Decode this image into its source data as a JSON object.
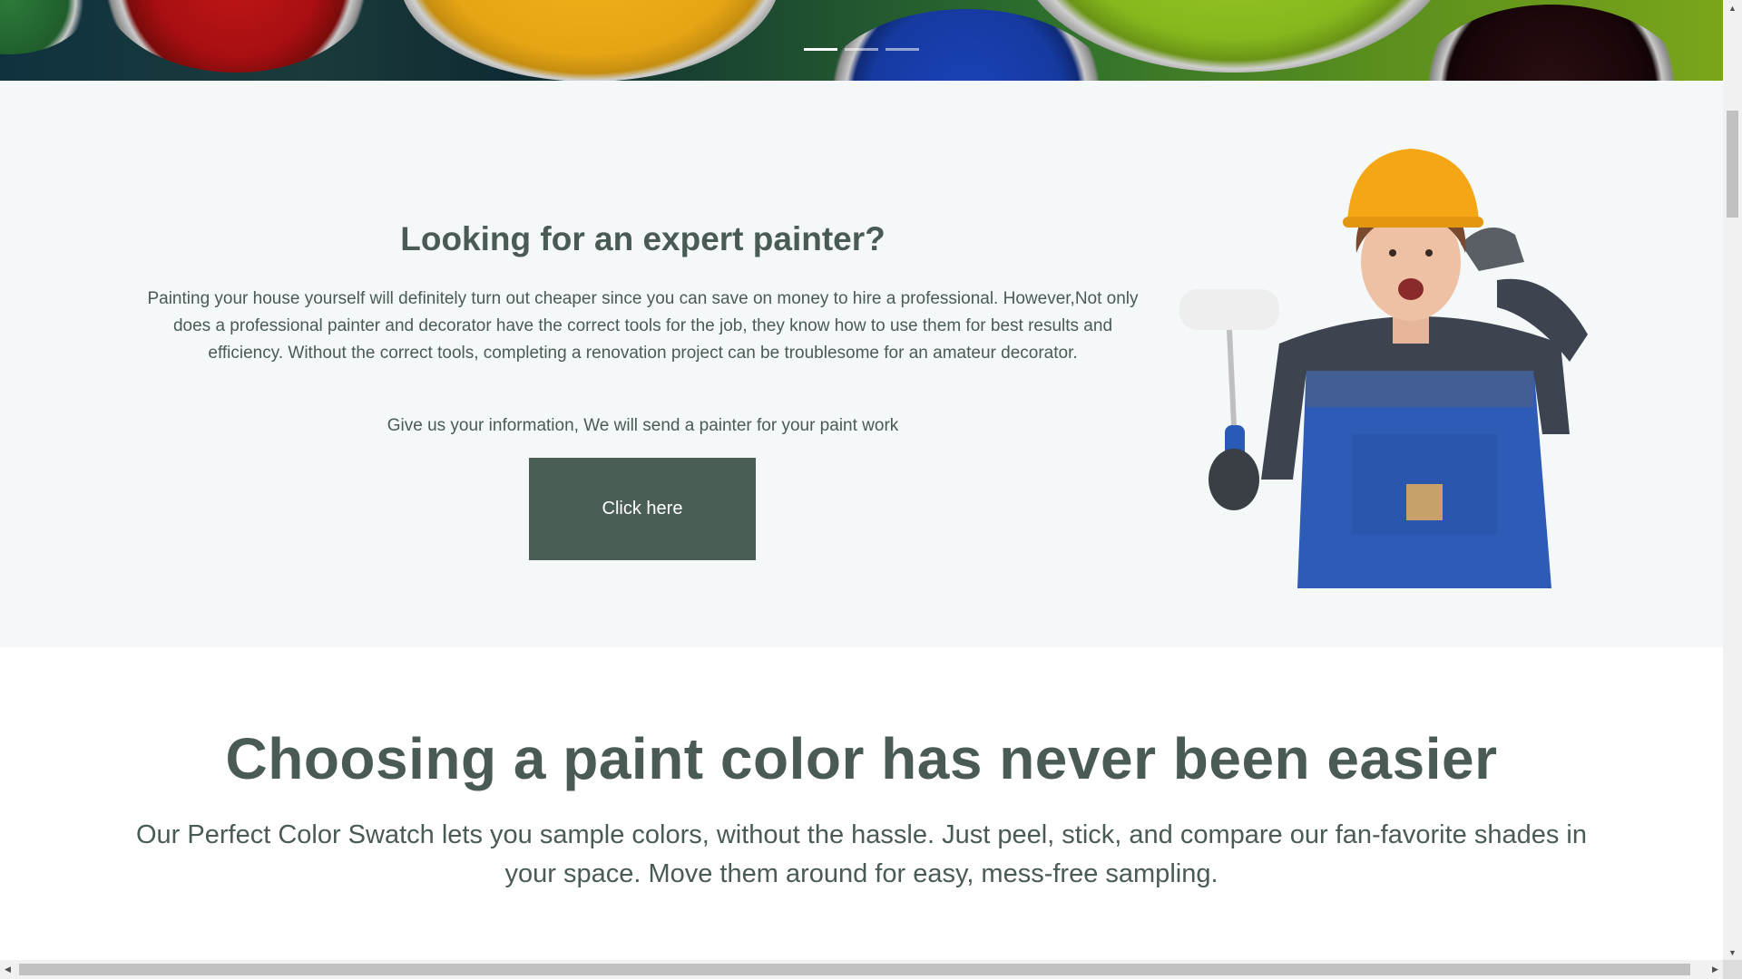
{
  "hero": {
    "slides": [
      {
        "label": "slide-1",
        "active": true
      },
      {
        "label": "slide-2",
        "active": false
      },
      {
        "label": "slide-3",
        "active": false
      }
    ]
  },
  "expert": {
    "title": "Looking for an expert painter?",
    "paragraph": "Painting your house yourself will definitely turn out cheaper since you can save on money to hire a professional. However,Not only does a professional painter and decorator have the correct tools for the job, they know how to use them for best results and efficiency. Without the correct tools, completing a renovation project can be troublesome for an amateur decorator.",
    "subtext": "Give us your information, We will send a painter for your paint work",
    "cta_label": "Click here"
  },
  "swatch": {
    "title": "Choosing a paint color has never been easier",
    "description": "Our Perfect Color Swatch lets you sample colors, without the hassle. Just peel, stick, and compare our fan-favorite shades in your space. Move them around for easy, mess-free sampling."
  },
  "colors": {
    "text": "#4a5a55",
    "cta_background": "#4b5e56",
    "section_background": "#f4f8f8"
  }
}
